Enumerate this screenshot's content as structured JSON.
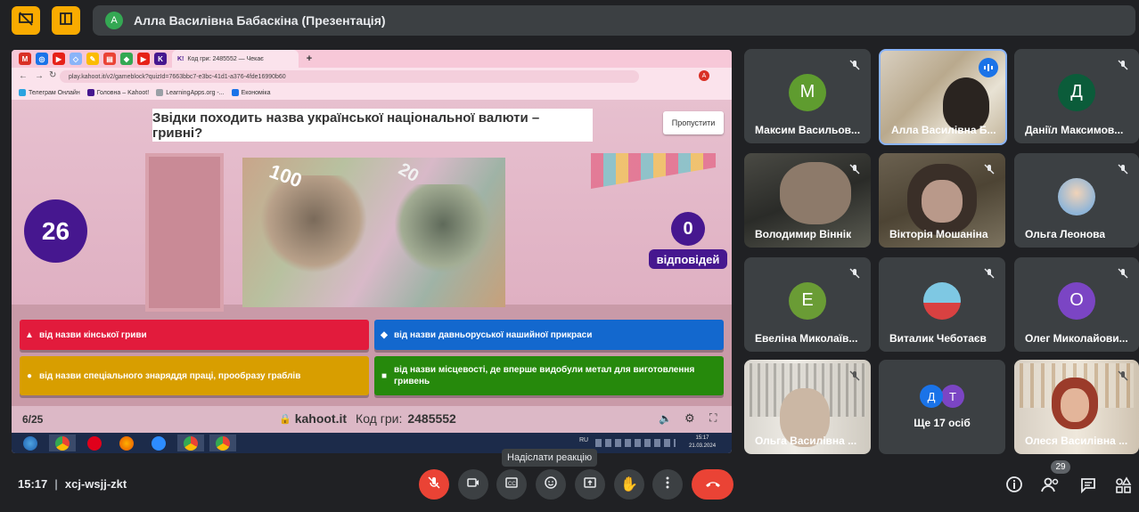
{
  "meet": {
    "presenter_initial": "А",
    "presenter_title": "Алла Василівна Бабаскіна (Презентація)",
    "time": "15:17",
    "meeting_code": "xcj-wsjj-zkt",
    "reaction_tooltip": "Надіслати реакцію",
    "participants_count": "29"
  },
  "browser": {
    "active_tab": "Код гри: 2485552 — Чекає",
    "url": "play.kahoot.it/v2/gameblock?quizId=7663bbc7-e3bc-41d1-a376-4fde16990b60",
    "profile_initial": "A",
    "bookmarks": [
      "Телеграм Онлайн",
      "Головна – Kahoot!",
      "LearningApps.org -...",
      "Економіка"
    ]
  },
  "kahoot": {
    "question": "Звідки походить назва української національної валюти – гривні?",
    "skip": "Пропустити",
    "timer": "26",
    "answers_count": "0",
    "answers_label": "відповідей",
    "answers": [
      {
        "symbol": "▲",
        "text": "від назви кінської гриви"
      },
      {
        "symbol": "◆",
        "text": "від назви давньоруської нашийної прикраси"
      },
      {
        "symbol": "●",
        "text": "від назви спеціального знаряддя праці, прообразу граблів"
      },
      {
        "symbol": "■",
        "text": "від назви місцевості, де вперше видобули метал для виготовлення гривень"
      }
    ],
    "progress": "6/25",
    "site": "kahoot.it",
    "pin_label": "Код гри:",
    "pin": "2485552"
  },
  "taskbar": {
    "lang": "RU",
    "time": "15:17",
    "date": "21.03.2024"
  },
  "participants": [
    {
      "name": "Максим Васильов...",
      "initial": "М",
      "color": "#5f9c2f"
    },
    {
      "name": "Алла Василівна Б...",
      "initial": "",
      "color": ""
    },
    {
      "name": "Даніїл Максимов...",
      "initial": "Д",
      "color": "#0b5c3a"
    },
    {
      "name": "Володимир Віннік",
      "initial": "",
      "color": ""
    },
    {
      "name": "Вікторія Мошаніна",
      "initial": "",
      "color": ""
    },
    {
      "name": "Ольга Леонова",
      "initial": "",
      "color": ""
    },
    {
      "name": "Евеліна Миколаїв...",
      "initial": "Е",
      "color": "#6a9c35"
    },
    {
      "name": "Виталик Чеботаєв",
      "initial": "",
      "color": ""
    },
    {
      "name": "Олег Миколайови...",
      "initial": "О",
      "color": "#7b45c4"
    },
    {
      "name": "Ольга Василівна ...",
      "initial": "",
      "color": ""
    },
    {
      "name": "Ще 17 осіб",
      "initial": "",
      "color": ""
    },
    {
      "name": "Олеся Василівна ...",
      "initial": "",
      "color": ""
    }
  ],
  "more_avatars": [
    "Д",
    "Т"
  ]
}
